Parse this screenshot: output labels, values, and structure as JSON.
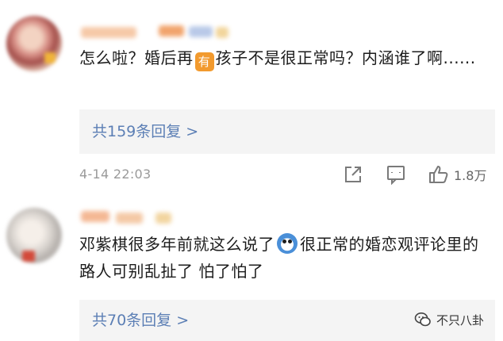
{
  "comments": [
    {
      "text_before_emoji": "怎么啦？婚后再",
      "emoji_label": "有",
      "text_after_emoji": "孩子不是很正常吗？内涵谁了啊......",
      "reply_label": "共159条回复 >",
      "timestamp": "4-14 22:03",
      "like_count": "1.8万"
    },
    {
      "text_before_emoji": "邓紫棋很多年前就这么说了",
      "emoji_label": "",
      "text_after_emoji": "很正常的婚恋观评论里的路人可别乱扯了 怕了怕了",
      "reply_label": "共70条回复 >"
    }
  ],
  "watermark": {
    "text": "不只八卦"
  },
  "icons": {
    "share": "share-icon",
    "comment": "comment-icon",
    "like": "thumbs-up-icon",
    "watermark": "wechat-logo-icon"
  },
  "colors": {
    "reply_link": "#5c7fb5",
    "reply_bg": "#f4f4f4",
    "emoji_badge": "#f29a2e"
  }
}
